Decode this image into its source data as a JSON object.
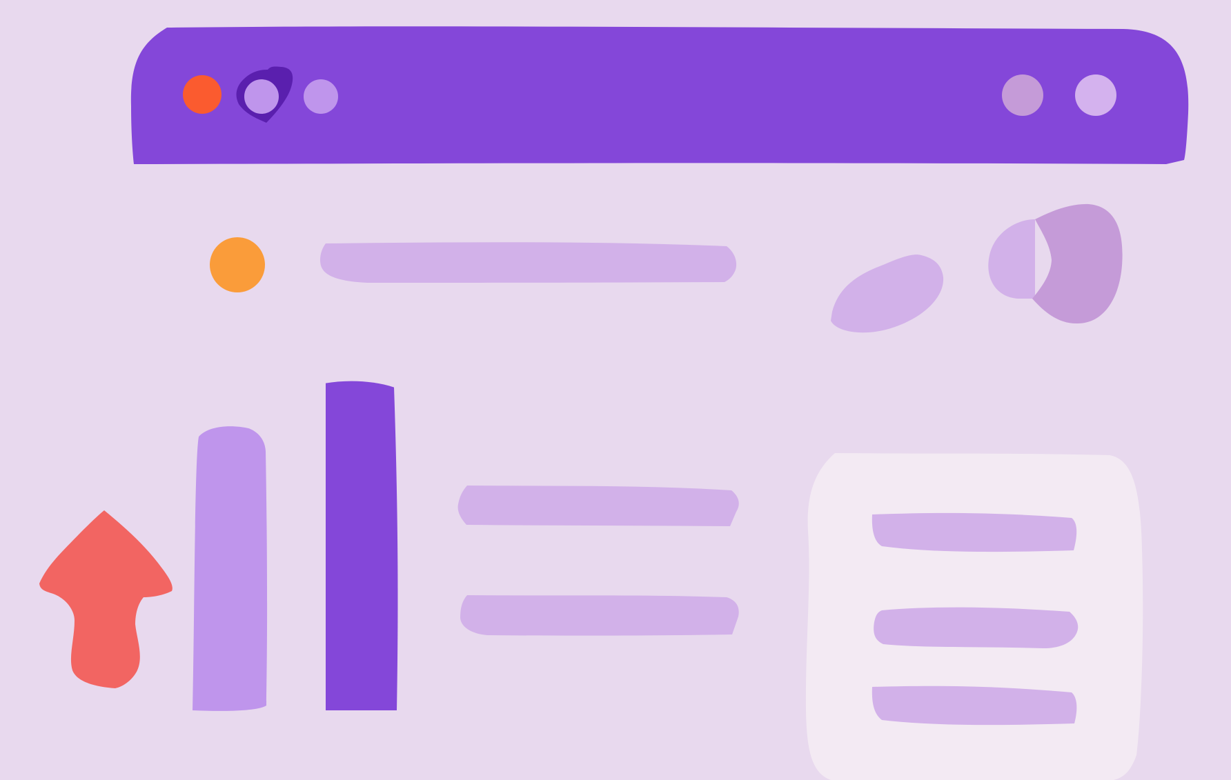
{
  "colors": {
    "background": "#e8d9ee",
    "title_bar": "#8447d9",
    "window_control_close": "#fb5b2f",
    "window_control_inactive": "#bf95ec",
    "window_control_focus_ring": "#5a1fae",
    "title_bar_right_button_1": "#c59bd8",
    "title_bar_right_button_2": "#d4b2ee",
    "avatar": "#fa9c3a",
    "placeholder_line": "#d2b1e9",
    "bar_light": "#bf95ec",
    "bar_dark": "#8447d9",
    "upload_arrow": "#f26562",
    "card_background": "#f3eaf3",
    "blob_light": "#d2b1e9",
    "blob_dark": "#c59bd8"
  },
  "icons": {
    "window_controls": [
      "close-button-icon",
      "minimize-button-icon",
      "maximize-button-icon"
    ],
    "title_bar_right": [
      "circle-button-icon",
      "circle-button-icon"
    ],
    "avatar": "avatar-circle-icon",
    "upload": "upload-arrow-icon",
    "decorative_shapes": [
      "leaf-blob-icon",
      "split-blob-icon"
    ]
  },
  "chart_data": {
    "type": "bar",
    "categories": [
      "",
      ""
    ],
    "values": [
      0.79,
      0.92
    ],
    "title": "",
    "xlabel": "",
    "ylabel": "",
    "legend": "none",
    "grid": false,
    "axis_labels_visible": false,
    "value_scale": "fraction-of-tallest-visible-range"
  }
}
